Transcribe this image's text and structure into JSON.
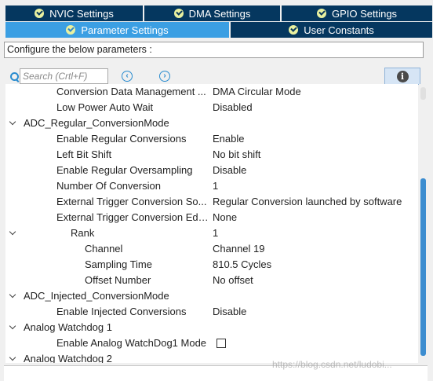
{
  "tabs_row1": [
    {
      "label": "NVIC Settings",
      "active": false
    },
    {
      "label": "DMA Settings",
      "active": false
    },
    {
      "label": "GPIO Settings",
      "active": false
    }
  ],
  "tabs_row2": [
    {
      "label": "Parameter Settings",
      "active": true
    },
    {
      "label": "User Constants",
      "active": false
    }
  ],
  "description": "Configure the below parameters :",
  "search": {
    "placeholder": "Search (Crtl+F)"
  },
  "tree": [
    {
      "name": "Conversion Data Management ...",
      "value": "DMA Circular Mode"
    },
    {
      "name": "Low Power Auto Wait",
      "value": "Disabled"
    },
    {
      "name": "ADC_Regular_ConversionMode",
      "value": ""
    },
    {
      "name": "Enable Regular Conversions",
      "value": "Enable"
    },
    {
      "name": "Left Bit Shift",
      "value": "No bit shift"
    },
    {
      "name": "Enable Regular Oversampling",
      "value": "Disable"
    },
    {
      "name": "Number Of Conversion",
      "value": "1"
    },
    {
      "name": "External Trigger Conversion So...",
      "value": "Regular Conversion launched by software"
    },
    {
      "name": "External Trigger Conversion Edge",
      "value": "None"
    },
    {
      "name": "Rank",
      "value": "1"
    },
    {
      "name": "Channel",
      "value": "Channel 19"
    },
    {
      "name": "Sampling Time",
      "value": "810.5 Cycles"
    },
    {
      "name": "Offset Number",
      "value": "No offset"
    },
    {
      "name": "ADC_Injected_ConversionMode",
      "value": ""
    },
    {
      "name": "Enable Injected Conversions",
      "value": "Disable"
    },
    {
      "name": "Analog Watchdog 1",
      "value": ""
    },
    {
      "name": "Enable Analog WatchDog1 Mode",
      "checked": false
    },
    {
      "name": "Analog Watchdog 2",
      "value": ""
    }
  ],
  "watermark": "https://blog.csdn.net/ludobi..."
}
